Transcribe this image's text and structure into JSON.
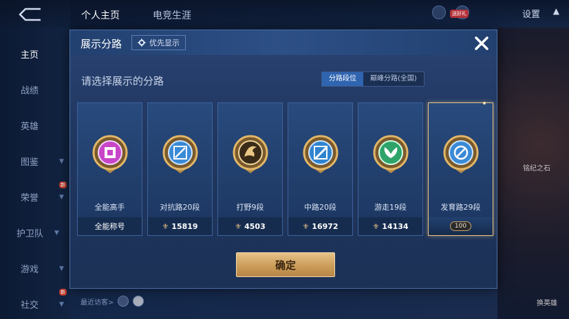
{
  "topbar": {
    "tabs": [
      "个人主页",
      "电竞生涯"
    ],
    "settings_label": "设置",
    "badge": "送好礼"
  },
  "sidebar": {
    "items": [
      {
        "label": "主页",
        "active": true
      },
      {
        "label": "战绩"
      },
      {
        "label": "英雄"
      },
      {
        "label": "图鉴"
      },
      {
        "label": "荣誉"
      },
      {
        "label": "护卫队"
      },
      {
        "label": "游戏"
      },
      {
        "label": "社交"
      }
    ],
    "new_badge": "新"
  },
  "background": {
    "recent_visitors_label": "最近访客>",
    "right_text_1": "铭纪之石",
    "right_text_2": "换英雄"
  },
  "modal": {
    "title": "展示分路",
    "priority_label": "优先显示",
    "subtitle": "请选择展示的分路",
    "toggle_options": [
      "分路段位",
      "巅峰分路(全国)"
    ],
    "active_toggle": 0,
    "confirm_label": "确定",
    "cards": [
      {
        "label": "全能高手",
        "footer": "全能称号",
        "badge_icon": "all-round-badge-icon",
        "badge_color": "#c845c8"
      },
      {
        "label": "对抗路20段",
        "footer": "15819",
        "badge_icon": "clash-lane-badge-icon",
        "badge_color": "#3a8ad6"
      },
      {
        "label": "打野9段",
        "footer": "4503",
        "badge_icon": "jungle-badge-icon",
        "badge_color": "#c89a4a"
      },
      {
        "label": "中路20段",
        "footer": "16972",
        "badge_icon": "mid-lane-badge-icon",
        "badge_color": "#2f83d0"
      },
      {
        "label": "游走19段",
        "footer": "14134",
        "badge_icon": "roam-badge-icon",
        "badge_color": "#2ea36a"
      },
      {
        "label": "发育路29段",
        "footer": "100",
        "badge_icon": "farm-lane-badge-icon",
        "badge_color": "#3a8ad6",
        "selected": true
      }
    ]
  }
}
